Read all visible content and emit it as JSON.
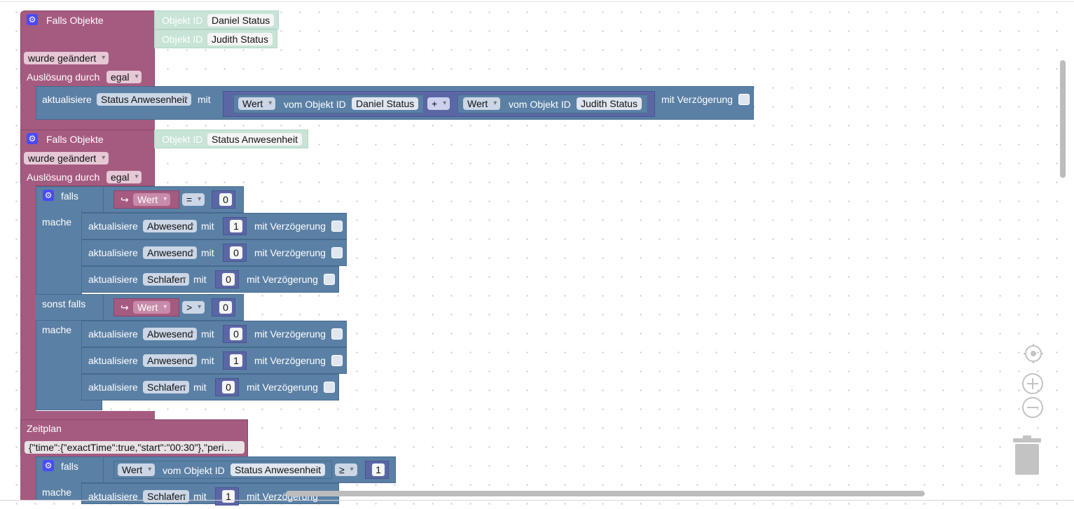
{
  "labels": {
    "falls_objekte": "Falls Objekte",
    "objekt_id": "Objekt ID",
    "wurde_geaendert": "wurde geändert",
    "ausloesung_durch": "Auslösung durch",
    "egal": "egal",
    "aktualisiere": "aktualisiere",
    "mit": "mit",
    "mit_verzoegerung": "mit Verzögerung",
    "wert": "Wert",
    "vom_objekt_id": "vom Objekt ID",
    "falls": "falls",
    "mache": "mache",
    "sonst_falls": "sonst falls",
    "zeitplan": "Zeitplan",
    "eq": "=",
    "gt": ">",
    "ge": "≥",
    "plus": "+"
  },
  "block1": {
    "objects": [
      "Daniel Status",
      "Judith Status"
    ],
    "target": "Status Anwesenheit",
    "left_obj": "Daniel Status",
    "right_obj": "Judith Status"
  },
  "block2": {
    "objects": [
      "Status Anwesenheit"
    ],
    "cond1_value": "0",
    "cond2_value": "0",
    "group1": [
      {
        "name": "Abwesend",
        "value": "1"
      },
      {
        "name": "Anwesend",
        "value": "0"
      },
      {
        "name": "Schlafen",
        "value": "0"
      }
    ],
    "group2": [
      {
        "name": "Abwesend",
        "value": "0"
      },
      {
        "name": "Anwesend",
        "value": "1"
      },
      {
        "name": "Schlafen",
        "value": "0"
      }
    ]
  },
  "block3": {
    "cron": "{\"time\":{\"exactTime\":true,\"start\":\"00:30\"},\"peri…",
    "cond_object": "Status Anwesenheit",
    "cond_value": "1",
    "action_name": "Schlafen",
    "action_value": "1"
  },
  "icons": [
    "gear-icon",
    "recenter-icon",
    "zoom-in-icon",
    "zoom-out-icon",
    "trash-icon"
  ]
}
